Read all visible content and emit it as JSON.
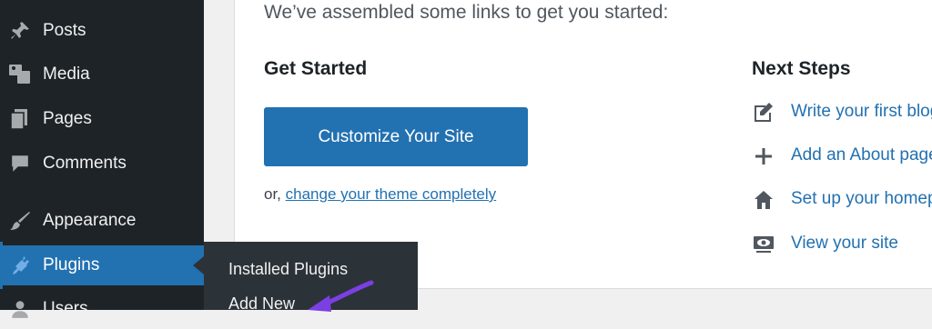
{
  "sidebar": {
    "items": [
      {
        "label": "Posts"
      },
      {
        "label": "Media"
      },
      {
        "label": "Pages"
      },
      {
        "label": "Comments"
      },
      {
        "label": "Appearance"
      },
      {
        "label": "Plugins"
      },
      {
        "label": "Users"
      }
    ],
    "active": "Plugins"
  },
  "flyout": {
    "items": [
      {
        "label": "Installed Plugins"
      },
      {
        "label": "Add New"
      }
    ]
  },
  "welcome": {
    "intro": "We’ve assembled some links to get you started:",
    "get_started": {
      "heading": "Get Started",
      "button_label": "Customize Your Site",
      "or_prefix": "or, ",
      "link_label": "change your theme completely"
    },
    "next_steps": {
      "heading": "Next Steps",
      "items": [
        {
          "label": "Write your first blog post",
          "icon": "edit-icon"
        },
        {
          "label": "Add an About page",
          "icon": "plus-icon"
        },
        {
          "label": "Set up your homepage",
          "icon": "home-icon"
        },
        {
          "label": "View your site",
          "icon": "view-site-icon"
        }
      ]
    }
  },
  "colors": {
    "sidebar_bg": "#1d2327",
    "flyout_bg": "#2c3338",
    "accent": "#2271b1",
    "annotation_arrow": "#7b3fe4"
  }
}
